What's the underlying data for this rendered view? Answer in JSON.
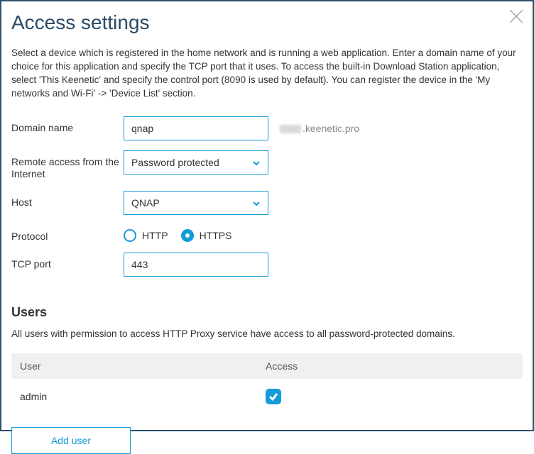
{
  "title": "Access settings",
  "description": "Select a device which is registered in the home network and is running a web application. Enter a domain name of your choice for this application and specify the TCP port that it uses. To access the built-in Download Station application, select 'This Keenetic' and specify the control port (8090 is used by default). You can register the device in the 'My networks and Wi-Fi' -> 'Device List' section.",
  "form": {
    "domain_name": {
      "label": "Domain name",
      "value": "qnap",
      "suffix": ".keenetic.pro"
    },
    "remote_access": {
      "label": "Remote access from the Internet",
      "value": "Password protected"
    },
    "host": {
      "label": "Host",
      "value": "QNAP"
    },
    "protocol": {
      "label": "Protocol",
      "options": [
        {
          "label": "HTTP",
          "checked": false
        },
        {
          "label": "HTTPS",
          "checked": true
        }
      ]
    },
    "tcp_port": {
      "label": "TCP port",
      "value": "443"
    }
  },
  "users": {
    "title": "Users",
    "description": "All users with permission to access HTTP Proxy service have access to all password-protected domains.",
    "columns": {
      "user": "User",
      "access": "Access"
    },
    "rows": [
      {
        "user": "admin",
        "access": true
      }
    ],
    "add_button": "Add user"
  }
}
